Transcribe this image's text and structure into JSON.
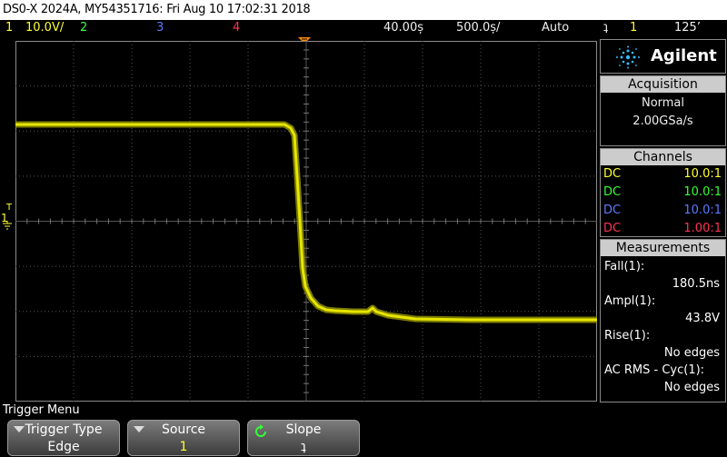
{
  "title": "DS0-X 2024A, MY54351716: Fri Aug 10 17:02:31 2018",
  "status": {
    "ch1_num": "1",
    "ch1_scale": "10.0V/",
    "ch2_num": "2",
    "ch3_num": "3",
    "ch4_num": "4",
    "delay": "40.00ș",
    "timebase": "500.0ș/",
    "trigger_mode": "Auto",
    "trigger_slope_symbol": "ʇ",
    "trigger_source": "1",
    "trigger_level": "125’"
  },
  "colors": {
    "ch1": "#ffff33",
    "ch2": "#33ff33",
    "ch3": "#3d6bff",
    "ch4": "#ff3355",
    "trace": "#d8d800"
  },
  "brand": {
    "name": "Agilent"
  },
  "acquisition": {
    "header": "Acquisition",
    "mode": "Normal",
    "rate": "2.00GSa/s"
  },
  "channels": {
    "header": "Channels",
    "rows": [
      {
        "coupling": "DC",
        "probe": "10.0:1"
      },
      {
        "coupling": "DC",
        "probe": "10.0:1"
      },
      {
        "coupling": "DC",
        "probe": "10.0:1"
      },
      {
        "coupling": "DC",
        "probe": "1.00:1"
      }
    ]
  },
  "measurements": {
    "header": "Measurements",
    "items": [
      {
        "label": "Fall(1):",
        "value": "180.5ns"
      },
      {
        "label": "Ampl(1):",
        "value": "43.8V"
      },
      {
        "label": "Rise(1):",
        "value": "No edges"
      },
      {
        "label": "AC RMS - Cyc(1):",
        "value": "No edges"
      }
    ]
  },
  "markers": {
    "ch1_marker": "1",
    "trigger_marker": "T"
  },
  "menu": {
    "title": "Trigger Menu",
    "keys": [
      {
        "label": "Trigger Type",
        "value": "Edge"
      },
      {
        "label": "Source",
        "value": "1"
      },
      {
        "label": "Slope",
        "value": "ʇ"
      }
    ]
  }
}
